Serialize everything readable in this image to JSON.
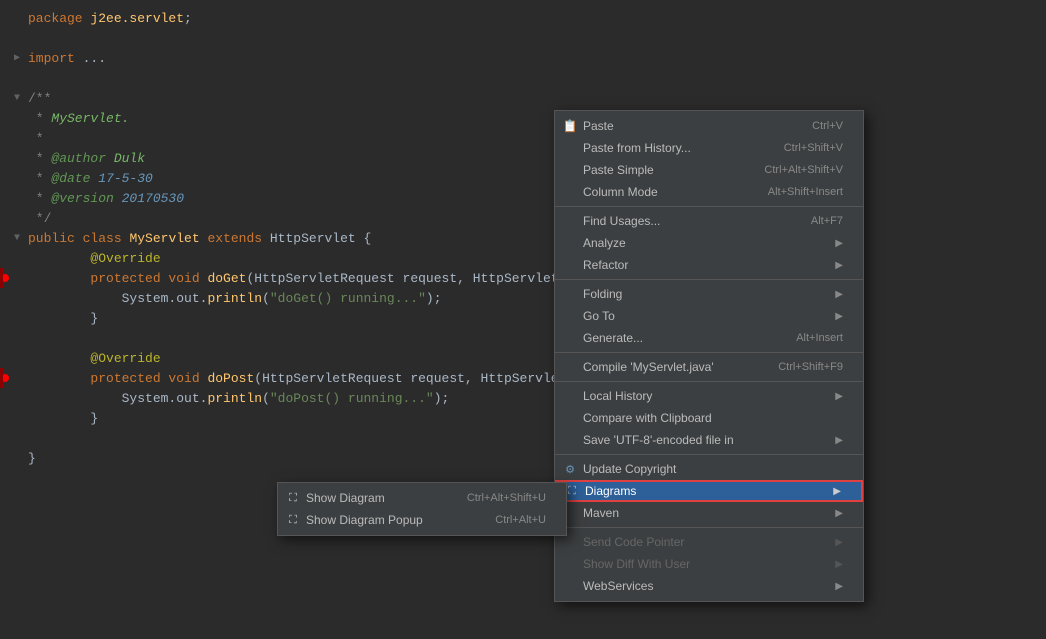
{
  "editor": {
    "lines": [
      {
        "id": 1,
        "indent": "",
        "content": "package j2ee.servlet;",
        "type": "package"
      },
      {
        "id": 2,
        "indent": "",
        "content": "",
        "type": "blank"
      },
      {
        "id": 3,
        "indent": "",
        "content": "import ...;",
        "type": "import",
        "foldable": true
      },
      {
        "id": 4,
        "indent": "",
        "content": "",
        "type": "blank"
      },
      {
        "id": 5,
        "indent": "",
        "content": "/**",
        "type": "doc",
        "foldable": true
      },
      {
        "id": 6,
        "indent": " * ",
        "content": "MyServlet.",
        "type": "doc"
      },
      {
        "id": 7,
        "indent": " *",
        "content": "",
        "type": "doc"
      },
      {
        "id": 8,
        "indent": " * ",
        "content": "@author Dulk",
        "type": "doc"
      },
      {
        "id": 9,
        "indent": " * ",
        "content": "@date 17-5-30",
        "type": "doc"
      },
      {
        "id": 10,
        "indent": " * ",
        "content": "@version 20170530",
        "type": "doc"
      },
      {
        "id": 11,
        "indent": " ",
        "content": "*/",
        "type": "doc"
      },
      {
        "id": 12,
        "indent": "",
        "content": "public class MyServlet extends HttpServlet {",
        "type": "class",
        "foldable": true
      },
      {
        "id": 13,
        "indent": "    ",
        "content": "@Override",
        "type": "annotation"
      },
      {
        "id": 14,
        "indent": "    ",
        "content": "protected void doGet(HttpServletRequest request, HttpServletRe...",
        "type": "method",
        "breakpoint": true
      },
      {
        "id": 15,
        "indent": "        ",
        "content": "System.out.println(\"doGet() running...\");",
        "type": "code"
      },
      {
        "id": 16,
        "indent": "    ",
        "content": "}",
        "type": "brace"
      },
      {
        "id": 17,
        "indent": "",
        "content": "",
        "type": "blank"
      },
      {
        "id": 18,
        "indent": "    ",
        "content": "@Override",
        "type": "annotation"
      },
      {
        "id": 19,
        "indent": "    ",
        "content": "protected void doPost(HttpServletRequest request, HttpServletP...",
        "type": "method",
        "breakpoint": true
      },
      {
        "id": 20,
        "indent": "        ",
        "content": "System.out.println(\"doPost() running...\");",
        "type": "code"
      },
      {
        "id": 21,
        "indent": "    ",
        "content": "}",
        "type": "brace"
      },
      {
        "id": 22,
        "indent": "",
        "content": "",
        "type": "blank"
      },
      {
        "id": 23,
        "indent": "",
        "content": "}",
        "type": "brace"
      }
    ]
  },
  "context_menu": {
    "items": [
      {
        "id": "paste",
        "label": "Paste",
        "shortcut": "Ctrl+V",
        "has_icon": true,
        "has_arrow": false,
        "disabled": false
      },
      {
        "id": "paste-history",
        "label": "Paste from History...",
        "shortcut": "Ctrl+Shift+V",
        "has_icon": false,
        "has_arrow": false,
        "disabled": false
      },
      {
        "id": "paste-simple",
        "label": "Paste Simple",
        "shortcut": "Ctrl+Alt+Shift+V",
        "has_icon": false,
        "has_arrow": false,
        "disabled": false
      },
      {
        "id": "column-mode",
        "label": "Column Mode",
        "shortcut": "Alt+Shift+Insert",
        "has_icon": false,
        "has_arrow": false,
        "disabled": false
      },
      {
        "id": "sep1",
        "type": "separator"
      },
      {
        "id": "find-usages",
        "label": "Find Usages...",
        "shortcut": "Alt+F7",
        "has_icon": false,
        "has_arrow": false,
        "disabled": false
      },
      {
        "id": "analyze",
        "label": "Analyze",
        "shortcut": "",
        "has_icon": false,
        "has_arrow": true,
        "disabled": false
      },
      {
        "id": "refactor",
        "label": "Refactor",
        "shortcut": "",
        "has_icon": false,
        "has_arrow": true,
        "disabled": false
      },
      {
        "id": "sep2",
        "type": "separator"
      },
      {
        "id": "folding",
        "label": "Folding",
        "shortcut": "",
        "has_icon": false,
        "has_arrow": true,
        "disabled": false
      },
      {
        "id": "go-to",
        "label": "Go To",
        "shortcut": "",
        "has_icon": false,
        "has_arrow": true,
        "disabled": false
      },
      {
        "id": "generate",
        "label": "Generate...",
        "shortcut": "Alt+Insert",
        "has_icon": false,
        "has_arrow": false,
        "disabled": false
      },
      {
        "id": "sep3",
        "type": "separator"
      },
      {
        "id": "compile",
        "label": "Compile 'MyServlet.java'",
        "shortcut": "Ctrl+Shift+F9",
        "has_icon": false,
        "has_arrow": false,
        "disabled": false
      },
      {
        "id": "sep4",
        "type": "separator"
      },
      {
        "id": "local-history",
        "label": "Local History",
        "shortcut": "",
        "has_icon": false,
        "has_arrow": true,
        "disabled": false
      },
      {
        "id": "compare-clipboard",
        "label": "Compare with Clipboard",
        "shortcut": "",
        "has_icon": false,
        "has_arrow": false,
        "disabled": false
      },
      {
        "id": "save-encoded",
        "label": "Save 'UTF-8'-encoded file in",
        "shortcut": "",
        "has_icon": false,
        "has_arrow": true,
        "disabled": false
      },
      {
        "id": "sep5",
        "type": "separator"
      },
      {
        "id": "update-copyright",
        "label": "Update Copyright",
        "shortcut": "",
        "has_icon": true,
        "has_arrow": false,
        "disabled": false
      },
      {
        "id": "diagrams",
        "label": "Diagrams",
        "shortcut": "",
        "has_icon": true,
        "has_arrow": true,
        "disabled": false,
        "highlighted": true
      },
      {
        "id": "maven",
        "label": "Maven",
        "shortcut": "",
        "has_icon": false,
        "has_arrow": true,
        "disabled": false
      },
      {
        "id": "sep6",
        "type": "separator"
      },
      {
        "id": "send-code-pointer",
        "label": "Send Code Pointer",
        "shortcut": "",
        "has_icon": false,
        "has_arrow": true,
        "disabled": true
      },
      {
        "id": "show-diff-user",
        "label": "Show Diff With User",
        "shortcut": "",
        "has_icon": false,
        "has_arrow": true,
        "disabled": true
      },
      {
        "id": "webservices",
        "label": "WebServices",
        "shortcut": "",
        "has_icon": false,
        "has_arrow": true,
        "disabled": false
      }
    ]
  },
  "submenu": {
    "items": [
      {
        "id": "show-diagram",
        "label": "Show Diagram",
        "shortcut": "Ctrl+Alt+Shift+U",
        "has_icon": true
      },
      {
        "id": "show-diagram-popup",
        "label": "Show Diagram Popup",
        "shortcut": "Ctrl+Alt+U",
        "has_icon": true
      }
    ]
  }
}
